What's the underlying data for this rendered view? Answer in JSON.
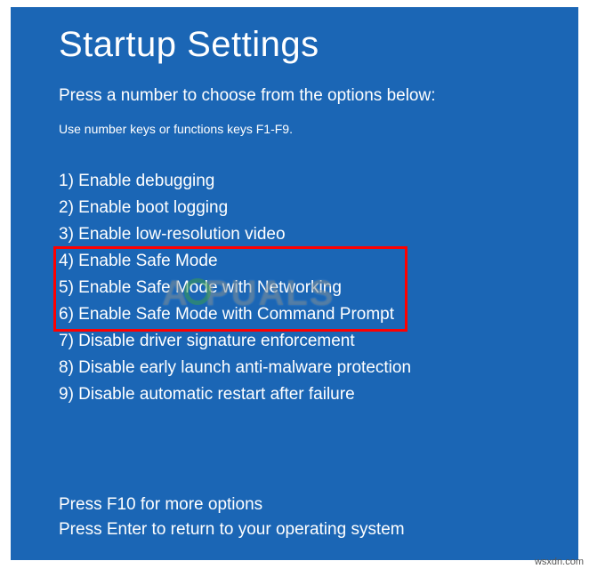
{
  "title": "Startup Settings",
  "subtitle": "Press a number to choose from the options below:",
  "hint": "Use number keys or functions keys F1-F9.",
  "options": [
    "1) Enable debugging",
    "2) Enable boot logging",
    "3) Enable low-resolution video",
    "4) Enable Safe Mode",
    "5) Enable Safe Mode with Networking",
    "6) Enable Safe Mode with Command Prompt",
    "7) Disable driver signature enforcement",
    "8) Disable early launch anti-malware protection",
    "9) Disable automatic restart after failure"
  ],
  "footer": {
    "more": "Press F10 for more options",
    "return": "Press Enter to return to your operating system"
  },
  "watermark": {
    "part1": "A",
    "part2": "PUALS"
  },
  "attribution": "wsxdn.com"
}
